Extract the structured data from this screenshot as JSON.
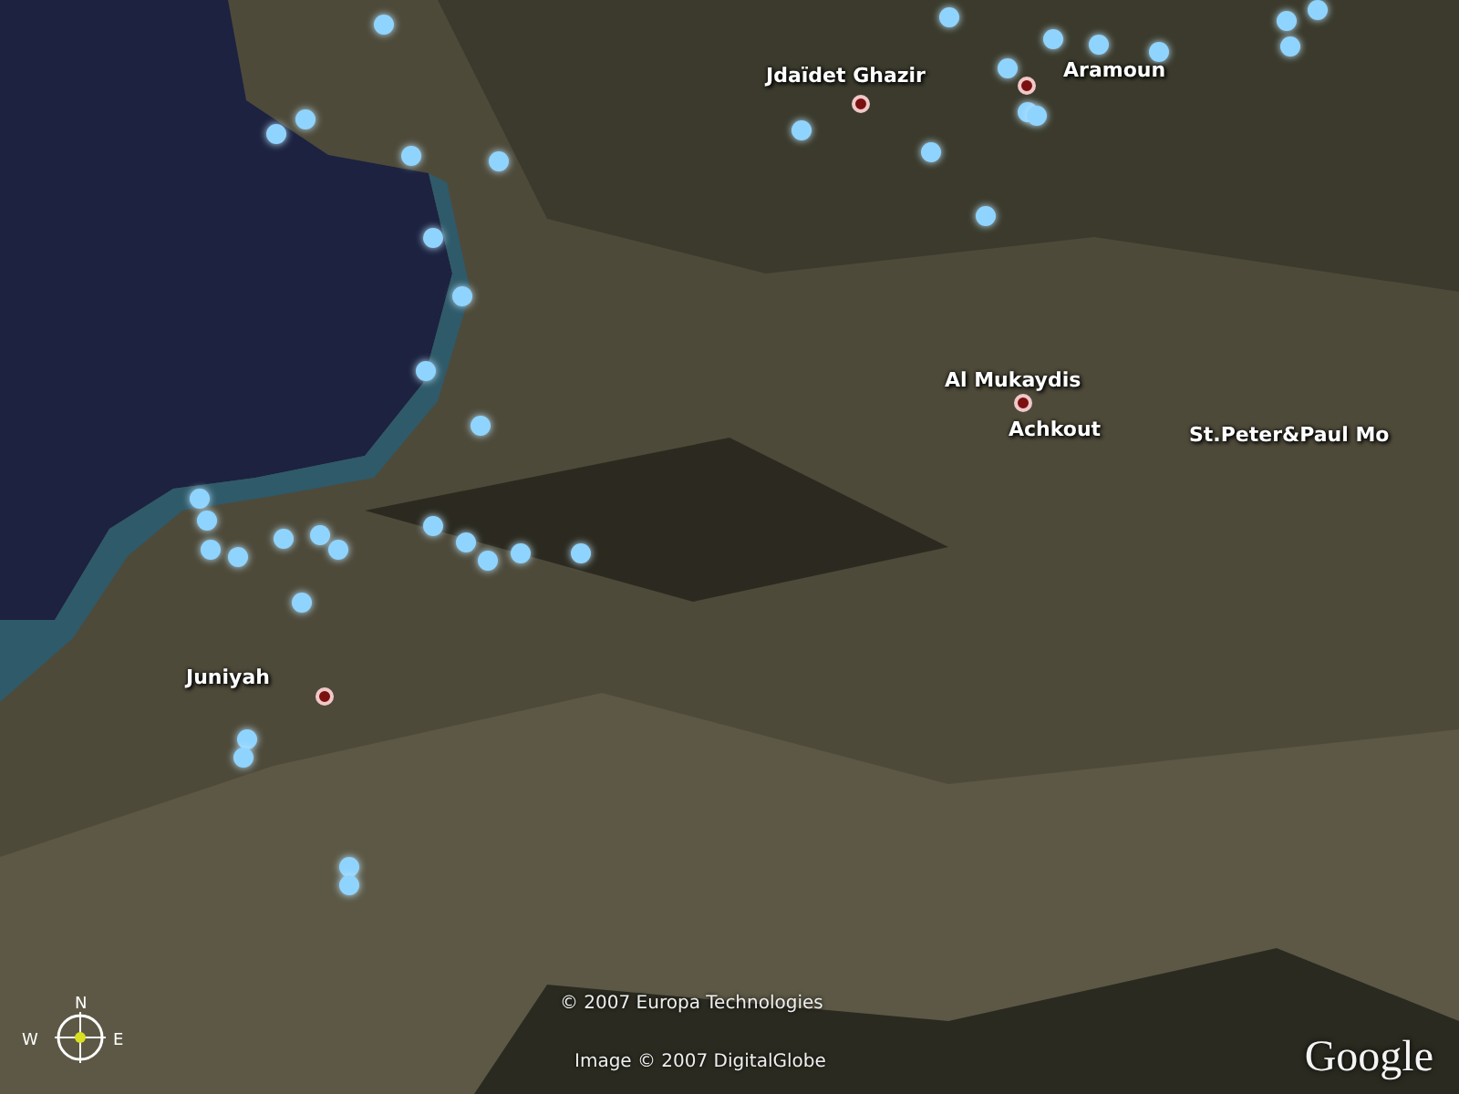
{
  "map": {
    "places": [
      {
        "name": "Jdaïdet Ghazir",
        "marker": true
      },
      {
        "name": "Aramoun",
        "marker": true
      },
      {
        "name": "Al Mukaydis",
        "marker": true
      },
      {
        "name": "Achkout",
        "marker": false
      },
      {
        "name": "St.Peter&Paul Mo",
        "marker": false
      },
      {
        "name": "Juniyah",
        "marker": true
      }
    ]
  },
  "compass": {
    "north": "N",
    "west": "W",
    "east": "E"
  },
  "attributions": [
    "© 2007 Europa Technologies",
    "Image © 2007 DigitalGlobe"
  ],
  "logo": "Google"
}
